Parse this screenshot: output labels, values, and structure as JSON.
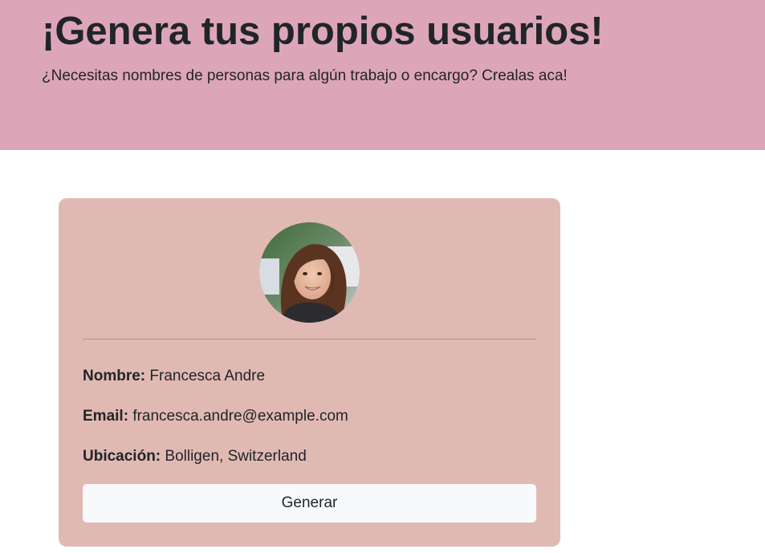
{
  "header": {
    "title": "¡Genera tus propios usuarios!",
    "subtitle": "¿Necesitas nombres de personas para algún trabajo o encargo? Crealas aca!"
  },
  "card": {
    "avatar_alt": "Francesca Andre",
    "name_label": "Nombre:",
    "name_value": "Francesca Andre",
    "email_label": "Email:",
    "email_value": "francesca.andre@example.com",
    "location_label": "Ubicación:",
    "location_value": "Bolligen, Switzerland",
    "button_label": "Generar"
  },
  "colors": {
    "hero_background": "#dda6b8",
    "card_background": "#e1b9b3",
    "button_background": "#f8f9fa",
    "text": "#212529"
  }
}
